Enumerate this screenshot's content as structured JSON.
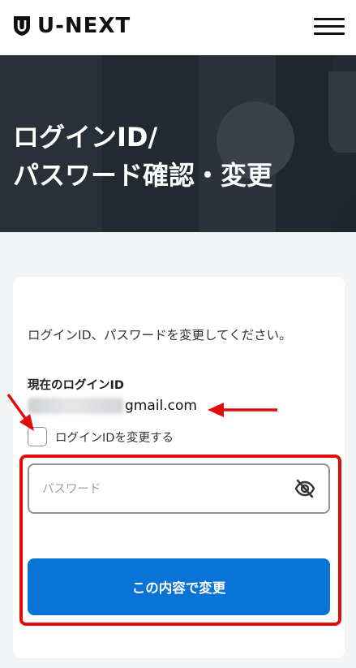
{
  "header": {
    "logo_text": "U-NEXT",
    "menu_icon": "hamburger-icon"
  },
  "hero": {
    "title_line1": "ログインID/",
    "title_line2": "パスワード確認・変更"
  },
  "form": {
    "description": "ログインID、パスワードを変更してください。",
    "current_id_label": "現在のログインID",
    "current_id_domain": "gmail.com",
    "change_id_label": "ログインIDを変更する",
    "change_id_checked": false,
    "password_placeholder": "パスワード",
    "password_value": "",
    "eye_icon": "eye-off-icon",
    "submit_label": "この内容で変更"
  },
  "colors": {
    "accent": "#0a73d6",
    "hero_bg": "#262c35",
    "annotation": "#e10d0d"
  }
}
